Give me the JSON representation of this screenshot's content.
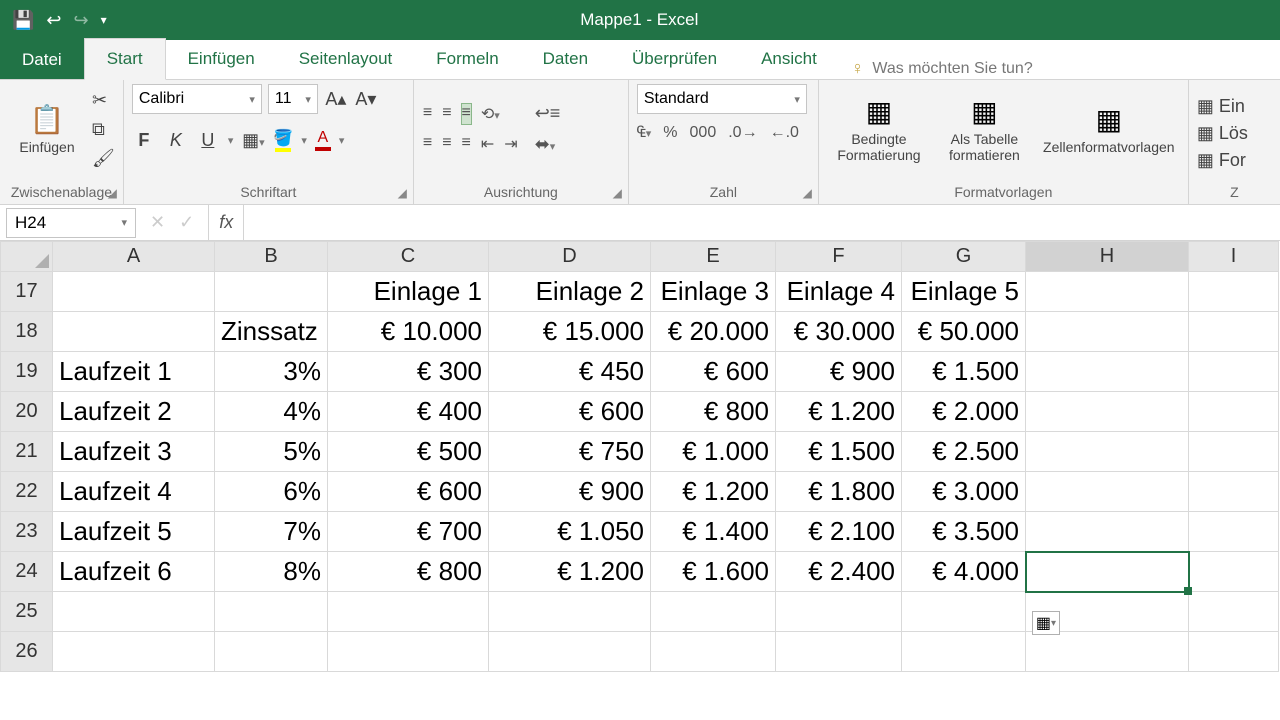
{
  "title": "Mappe1 - Excel",
  "tabs": {
    "file": "Datei",
    "start": "Start",
    "einfuegen": "Einfügen",
    "seitenlayout": "Seitenlayout",
    "formeln": "Formeln",
    "daten": "Daten",
    "ueberpruefen": "Überprüfen",
    "ansicht": "Ansicht"
  },
  "tellme": {
    "placeholder": "Was möchten Sie tun?"
  },
  "ribbon": {
    "clipboard": {
      "paste": "Einfügen",
      "group": "Zwischenablage"
    },
    "font": {
      "name": "Calibri",
      "size": "11",
      "group": "Schriftart"
    },
    "alignment": {
      "group": "Ausrichtung"
    },
    "number": {
      "format": "Standard",
      "group": "Zahl"
    },
    "styles": {
      "cond": "Bedingte Formatierung",
      "table": "Als Tabelle formatieren",
      "cell": "Zellenformatvorlagen",
      "group": "Formatvorlagen"
    },
    "cells": {
      "insert": "Ein",
      "delete": "Lös",
      "format": "For"
    }
  },
  "namebox": "H24",
  "formula": "",
  "columns": [
    "A",
    "B",
    "C",
    "D",
    "E",
    "F",
    "G",
    "H",
    "I"
  ],
  "rows": [
    "17",
    "18",
    "19",
    "20",
    "21",
    "22",
    "23",
    "24",
    "25",
    "26"
  ],
  "sheet": {
    "r17": {
      "C": "Einlage 1",
      "D": "Einlage 2",
      "E": "Einlage 3",
      "F": "Einlage 4",
      "G": "Einlage 5"
    },
    "r18": {
      "B": "Zinssatz",
      "C": "€ 10.000",
      "D": "€ 15.000",
      "E": "€ 20.000",
      "F": "€ 30.000",
      "G": "€ 50.000"
    },
    "r19": {
      "A": "Laufzeit 1",
      "B": "3%",
      "C": "€ 300",
      "D": "€ 450",
      "E": "€ 600",
      "F": "€ 900",
      "G": "€ 1.500"
    },
    "r20": {
      "A": "Laufzeit 2",
      "B": "4%",
      "C": "€ 400",
      "D": "€ 600",
      "E": "€ 800",
      "F": "€ 1.200",
      "G": "€ 2.000"
    },
    "r21": {
      "A": "Laufzeit 3",
      "B": "5%",
      "C": "€ 500",
      "D": "€ 750",
      "E": "€ 1.000",
      "F": "€ 1.500",
      "G": "€ 2.500"
    },
    "r22": {
      "A": "Laufzeit 4",
      "B": "6%",
      "C": "€ 600",
      "D": "€ 900",
      "E": "€ 1.200",
      "F": "€ 1.800",
      "G": "€ 3.000"
    },
    "r23": {
      "A": "Laufzeit 5",
      "B": "7%",
      "C": "€ 700",
      "D": "€ 1.050",
      "E": "€ 1.400",
      "F": "€ 2.100",
      "G": "€ 3.500"
    },
    "r24": {
      "A": "Laufzeit 6",
      "B": "8%",
      "C": "€ 800",
      "D": "€ 1.200",
      "E": "€ 1.600",
      "F": "€ 2.400",
      "G": "€ 4.000"
    }
  },
  "selected_cell": "H24"
}
